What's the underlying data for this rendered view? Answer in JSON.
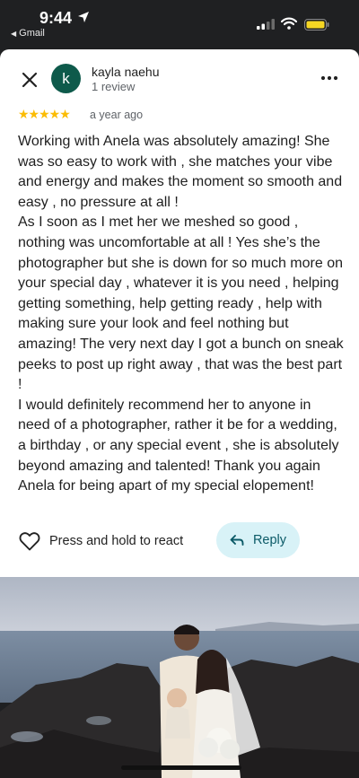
{
  "status_bar": {
    "time": "9:44",
    "back_app": "Gmail"
  },
  "reviewer": {
    "avatar_letter": "k",
    "name": "kayla naehu",
    "review_count": "1 review",
    "avatar_color": "#0e5a4b"
  },
  "rating": {
    "stars": 5,
    "stars_text": "★★★★★",
    "time_ago": "a year ago",
    "star_color": "#fbbc04"
  },
  "review_text": "Working with Anela was absolutely amazing! She was so easy to work with , she matches your vibe and energy and makes the moment so smooth and easy , no pressure at all !\nAs I soon as I met her we meshed so good , nothing was uncomfortable at all ! Yes she’s the photographer but she is down for so much more on your special day , whatever it is you need , helping getting something, help getting ready , help with making sure your look and feel nothing but amazing! The very next day I got a bunch on sneak peeks to post up right away , that was the best part !\nI would definitely recommend her to anyone in need of a photographer, rather it be for a wedding, a birthday , or any special event , she is absolutely beyond amazing and talented! Thank you again Anela for being apart of my special elopement!",
  "actions": {
    "react_label": "Press and hold to react",
    "reply_label": "Reply",
    "reply_bg": "#d8f2f7"
  },
  "icons": [
    "location-arrow-icon",
    "signal-icon",
    "wifi-icon",
    "battery-icon",
    "close-icon",
    "more-options-icon",
    "heart-icon",
    "reply-arrow-icon"
  ]
}
